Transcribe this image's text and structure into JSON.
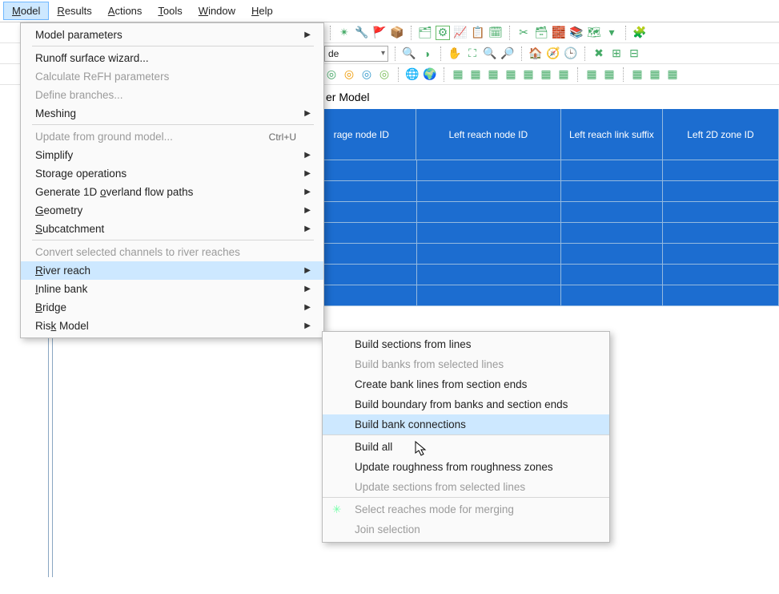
{
  "menubar": {
    "items": [
      {
        "label": "Model",
        "ul": "M",
        "active": true
      },
      {
        "label": "Results",
        "ul": "R"
      },
      {
        "label": "Actions",
        "ul": "A"
      },
      {
        "label": "Tools",
        "ul": "T"
      },
      {
        "label": "Window",
        "ul": "W"
      },
      {
        "label": "Help",
        "ul": "H"
      }
    ]
  },
  "toolbar1_combo": "de",
  "title_input_value": "er Model",
  "table": {
    "headers": [
      "rage node ID",
      "Left reach node ID",
      "Left reach link suffix",
      "Left 2D zone ID"
    ]
  },
  "model_menu": {
    "items": [
      {
        "label": "Model parameters",
        "submenu": true,
        "divider": true
      },
      {
        "label": "Runoff surface wizard..."
      },
      {
        "label": "Calculate ReFH parameters",
        "disabled": true
      },
      {
        "label": "Define branches...",
        "disabled": true
      },
      {
        "label": "Meshing",
        "submenu": true,
        "divider": true
      },
      {
        "label": "Update from ground model...",
        "disabled": true,
        "shortcut": "Ctrl+U"
      },
      {
        "label": "Simplify",
        "submenu": true
      },
      {
        "label": "Storage operations",
        "submenu": true
      },
      {
        "label": "Generate 1D overland flow paths",
        "submenu": true,
        "ul": "o"
      },
      {
        "label": "Geometry",
        "submenu": true,
        "ul": "G"
      },
      {
        "label": "Subcatchment",
        "submenu": true,
        "ul": "S",
        "divider": true
      },
      {
        "label": "Convert selected channels to river reaches",
        "disabled": true
      },
      {
        "label": "River reach",
        "submenu": true,
        "ul": "R",
        "highlight": true
      },
      {
        "label": "Inline bank",
        "submenu": true,
        "ul": "I"
      },
      {
        "label": "Bridge",
        "submenu": true,
        "ul": "B"
      },
      {
        "label": "Risk Model",
        "submenu": true,
        "ul": "k"
      }
    ]
  },
  "river_reach_submenu": {
    "items": [
      {
        "label": "Build sections from lines"
      },
      {
        "label": "Build banks from selected lines",
        "disabled": true
      },
      {
        "label": "Create bank lines from section ends"
      },
      {
        "label": "Build boundary from banks and section ends"
      },
      {
        "label": "Build bank connections",
        "highlight": true,
        "divider": true
      },
      {
        "label": "Build all"
      },
      {
        "label": "Update roughness from roughness zones"
      },
      {
        "label": "Update sections from selected lines",
        "disabled": true,
        "divider": true
      },
      {
        "label": "Select reaches mode for merging",
        "disabled": true,
        "icon": true
      },
      {
        "label": "Join selection",
        "disabled": true
      }
    ]
  }
}
